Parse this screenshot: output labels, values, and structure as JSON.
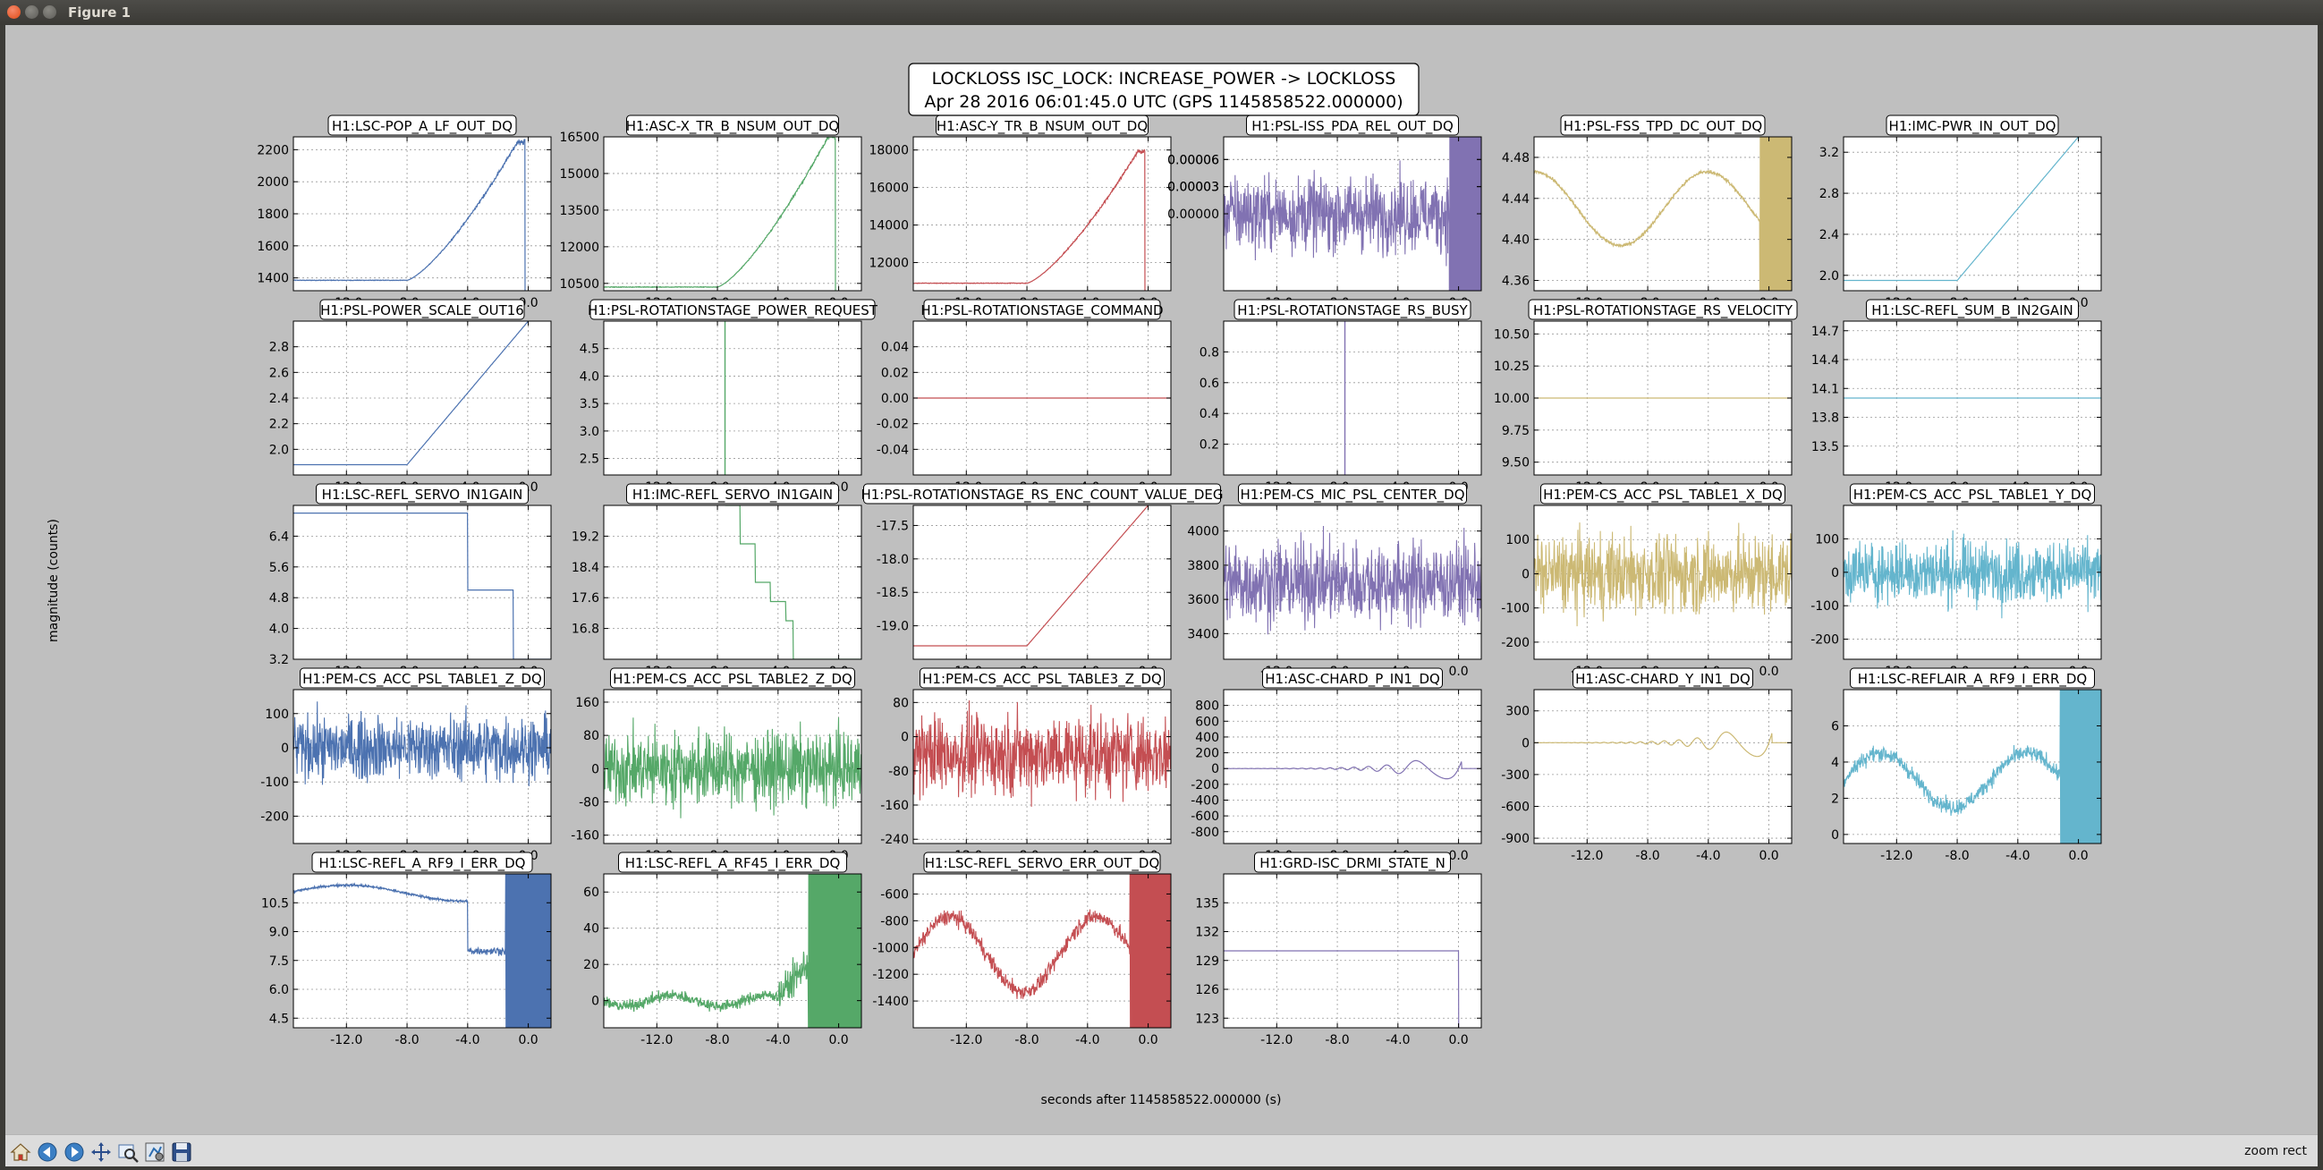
{
  "window": {
    "title": "Figure 1"
  },
  "figure": {
    "suptitle_line1": "LOCKLOSS ISC_LOCK: INCREASE_POWER -> LOCKLOSS",
    "suptitle_line2": "Apr 28 2016 06:01:45.0 UTC (GPS 1145858522.000000)",
    "ylabel": "magnitude (counts)",
    "xlabel": "seconds after 1145858522.000000 (s)"
  },
  "toolbar": {
    "icons": [
      "home-icon",
      "back-icon",
      "forward-icon",
      "pan-icon",
      "zoom-icon",
      "configure-icon",
      "save-icon"
    ],
    "status": "zoom rect"
  },
  "colors": {
    "blue": "#4c72b0",
    "green": "#55a868",
    "red": "#c44e52",
    "purple": "#8172b2",
    "gold": "#ccb974",
    "cyan": "#64b5cd"
  },
  "chart_data": [
    {
      "type": "line",
      "title": "H1:LSC-POP_A_LF_OUT_DQ",
      "color": "blue",
      "ylim": [
        1320,
        2280
      ],
      "yticks": [
        1400,
        1600,
        1800,
        2000,
        2200
      ],
      "xticks": [
        "-12.0",
        "-8.0",
        "-4.0",
        "0.0"
      ],
      "kind": "ramp",
      "base": 1385,
      "peak": 2250
    },
    {
      "type": "line",
      "title": "H1:ASC-X_TR_B_NSUM_OUT_DQ",
      "color": "green",
      "ylim": [
        10200,
        16500
      ],
      "yticks": [
        10500,
        12000,
        13500,
        15000,
        16500
      ],
      "xticks": [
        "-12.0",
        "-8.0",
        "-4.0",
        "0.0"
      ],
      "kind": "ramp",
      "base": 10350,
      "peak": 16500
    },
    {
      "type": "line",
      "title": "H1:ASC-Y_TR_B_NSUM_OUT_DQ",
      "color": "red",
      "ylim": [
        10500,
        18700
      ],
      "yticks": [
        12000,
        14000,
        16000,
        18000
      ],
      "xticks": [
        "-12.0",
        "-8.0",
        "-4.0",
        "0.0"
      ],
      "kind": "ramp",
      "base": 10900,
      "peak": 17900
    },
    {
      "type": "line",
      "title": "H1:PSL-ISS_PDA_REL_OUT_DQ",
      "color": "purple",
      "ylim": [
        -8.5e-05,
        8.5e-05
      ],
      "yticks": [
        "0.00006",
        "0.00003",
        "0.00000",
        "0.00003",
        "0.00006"
      ],
      "xticks": [
        "-12.0",
        "-8.0",
        "-4.0",
        "0.0"
      ],
      "kind": "noisewall",
      "amp": 5e-05
    },
    {
      "type": "line",
      "title": "H1:PSL-FSS_TPD_DC_OUT_DQ",
      "color": "gold",
      "ylim": [
        4.35,
        4.5
      ],
      "yticks": [
        "4.36",
        "4.40",
        "4.44",
        "4.48"
      ],
      "xticks": [
        "-12.0",
        "-8.0",
        "-4.0",
        "0.0"
      ],
      "kind": "wavefinal",
      "mid": 4.43,
      "amp": 0.04
    },
    {
      "type": "line",
      "title": "H1:IMC-PWR_IN_OUT_DQ",
      "color": "cyan",
      "ylim": [
        1.85,
        3.35
      ],
      "yticks": [
        "2.0",
        "2.4",
        "2.8",
        "3.2"
      ],
      "xticks": [
        "-12.0",
        "-8.0",
        "-4.0",
        "0.0"
      ],
      "kind": "linramp",
      "base": 1.95,
      "peak": 3.35
    },
    {
      "type": "line",
      "title": "H1:PSL-POWER_SCALE_OUT16",
      "color": "blue",
      "ylim": [
        1.8,
        3.0
      ],
      "yticks": [
        "2.0",
        "2.2",
        "2.4",
        "2.6",
        "2.8"
      ],
      "xticks": [
        "-12.0",
        "-8.0",
        "-4.0",
        "0.0"
      ],
      "kind": "linramp",
      "base": 1.88,
      "peak": 3.0
    },
    {
      "type": "line",
      "title": "H1:PSL-ROTATIONSTAGE_POWER_REQUEST",
      "color": "green",
      "ylim": [
        2.2,
        5.0
      ],
      "yticks": [
        "2.5",
        "3.0",
        "3.5",
        "4.0",
        "4.5"
      ],
      "xticks": [
        "-12.0",
        "-8.0",
        "-4.0",
        "0.0"
      ],
      "kind": "vline",
      "vx": -7.5
    },
    {
      "type": "line",
      "title": "H1:PSL-ROTATIONSTAGE_COMMAND",
      "color": "red",
      "ylim": [
        -0.06,
        0.06
      ],
      "yticks": [
        "0.04",
        "0.02",
        "0.00",
        "-0.02",
        "-0.04"
      ],
      "xticks": [
        "-12.0",
        "-8.0",
        "-4.0",
        "0.0"
      ],
      "kind": "flat",
      "level": 0
    },
    {
      "type": "line",
      "title": "H1:PSL-ROTATIONSTAGE_RS_BUSY",
      "color": "purple",
      "ylim": [
        0,
        1.0
      ],
      "yticks": [
        "0.2",
        "0.4",
        "0.6",
        "0.8"
      ],
      "xticks": [
        "-12.0",
        "-8.0",
        "-4.0",
        "0.0"
      ],
      "kind": "vline",
      "vx": -7.5
    },
    {
      "type": "line",
      "title": "H1:PSL-ROTATIONSTAGE_RS_VELOCITY",
      "color": "gold",
      "ylim": [
        9.4,
        10.6
      ],
      "yticks": [
        "9.50",
        "9.75",
        "10.00",
        "10.25",
        "10.50"
      ],
      "xticks": [
        "-12.0",
        "-8.0",
        "-4.0",
        "0.0"
      ],
      "kind": "flat",
      "level": 10.0
    },
    {
      "type": "line",
      "title": "H1:LSC-REFL_SUM_B_IN2GAIN",
      "color": "cyan",
      "ylim": [
        13.2,
        14.8
      ],
      "yticks": [
        "13.5",
        "13.8",
        "14.1",
        "14.4",
        "14.7"
      ],
      "xticks": [
        "-12.0",
        "-8.0",
        "-4.0",
        "0.0"
      ],
      "kind": "flat",
      "level": 14.0
    },
    {
      "type": "line",
      "title": "H1:LSC-REFL_SERVO_IN1GAIN",
      "color": "blue",
      "ylim": [
        3.2,
        7.2
      ],
      "yticks": [
        "3.2",
        "4.0",
        "4.8",
        "5.6",
        "6.4"
      ],
      "xticks": [
        "-12.0",
        "-8.0",
        "-4.0",
        "0.0"
      ],
      "kind": "steps",
      "steps": [
        [
          -15.5,
          7.0
        ],
        [
          -4.0,
          5.0
        ],
        [
          -1.0,
          3.2
        ]
      ]
    },
    {
      "type": "line",
      "title": "H1:IMC-REFL_SERVO_IN1GAIN",
      "color": "green",
      "ylim": [
        16.0,
        20.0
      ],
      "yticks": [
        "16.8",
        "17.6",
        "18.4",
        "19.2"
      ],
      "xticks": [
        "-12.0",
        "-8.0",
        "-4.0",
        "0.0"
      ],
      "kind": "steps",
      "steps": [
        [
          -7.5,
          20.0
        ],
        [
          -6.5,
          19.0
        ],
        [
          -5.5,
          18.0
        ],
        [
          -4.5,
          17.5
        ],
        [
          -3.5,
          17.0
        ],
        [
          -3.0,
          16.0
        ]
      ]
    },
    {
      "type": "line",
      "title": "H1:PSL-ROTATIONSTAGE_RS_ENC_COUNT_VALUE_DEG",
      "color": "red",
      "ylim": [
        -19.5,
        -17.2
      ],
      "yticks": [
        "-19.0",
        "-18.5",
        "-18.0",
        "-17.5"
      ],
      "xticks": [
        "-12.0",
        "-8.0",
        "-4.0",
        "0.0"
      ],
      "kind": "linramp",
      "base": -19.3,
      "peak": -17.2
    },
    {
      "type": "line",
      "title": "H1:PEM-CS_MIC_PSL_CENTER_DQ",
      "color": "purple",
      "ylim": [
        3250,
        4150
      ],
      "yticks": [
        3400,
        3600,
        3800,
        4000
      ],
      "xticks": [
        "-12.0",
        "-8.0",
        "-4.0",
        "0.0"
      ],
      "kind": "noise",
      "mid": 3700,
      "amp": 230
    },
    {
      "type": "line",
      "title": "H1:PEM-CS_ACC_PSL_TABLE1_X_DQ",
      "color": "gold",
      "ylim": [
        -250,
        200
      ],
      "yticks": [
        -200,
        -100,
        0,
        100
      ],
      "xticks": [
        "-12.0",
        "-8.0",
        "-4.0",
        "0.0"
      ],
      "kind": "noise",
      "mid": 0,
      "amp": 110
    },
    {
      "type": "line",
      "title": "H1:PEM-CS_ACC_PSL_TABLE1_Y_DQ",
      "color": "cyan",
      "ylim": [
        -260,
        200
      ],
      "yticks": [
        -200,
        -100,
        0,
        100
      ],
      "xticks": [
        "-12.0",
        "-8.0",
        "-4.0",
        "0.0"
      ],
      "kind": "noise",
      "mid": 0,
      "amp": 90
    },
    {
      "type": "line",
      "title": "H1:PEM-CS_ACC_PSL_TABLE1_Z_DQ",
      "color": "blue",
      "ylim": [
        -280,
        170
      ],
      "yticks": [
        -200,
        -100,
        0,
        100
      ],
      "xticks": [
        "-12.0",
        "-8.0",
        "-4.0",
        "0.0"
      ],
      "kind": "noise",
      "mid": 0,
      "amp": 90
    },
    {
      "type": "line",
      "title": "H1:PEM-CS_ACC_PSL_TABLE2_Z_DQ",
      "color": "green",
      "ylim": [
        -180,
        190
      ],
      "yticks": [
        -160,
        -80,
        0,
        80,
        160
      ],
      "xticks": [
        "-12.0",
        "-8.0",
        "-4.0",
        "0.0"
      ],
      "kind": "noise",
      "mid": 0,
      "amp": 85
    },
    {
      "type": "line",
      "title": "H1:PEM-CS_ACC_PSL_TABLE3_Z_DQ",
      "color": "red",
      "ylim": [
        -250,
        110
      ],
      "yticks": [
        -240,
        -160,
        -80,
        0,
        80
      ],
      "xticks": [
        "-12.0",
        "-8.0",
        "-4.0",
        "0.0"
      ],
      "kind": "noise",
      "mid": -40,
      "amp": 90
    },
    {
      "type": "line",
      "title": "H1:ASC-CHARD_P_IN1_DQ",
      "color": "purple",
      "ylim": [
        -950,
        1000
      ],
      "yticks": [
        -800,
        -600,
        -400,
        -200,
        0,
        200,
        400,
        600,
        800
      ],
      "xticks": [
        "-12.0",
        "-8.0",
        "-4.0",
        "0.0"
      ],
      "kind": "chirp",
      "amp": 900
    },
    {
      "type": "line",
      "title": "H1:ASC-CHARD_Y_IN1_DQ",
      "color": "gold",
      "ylim": [
        -950,
        500
      ],
      "yticks": [
        -900,
        -600,
        -300,
        0,
        300
      ],
      "xticks": [
        "-12.0",
        "-8.0",
        "-4.0",
        "0.0"
      ],
      "kind": "chirp",
      "amp": 900
    },
    {
      "type": "line",
      "title": "H1:LSC-REFLAIR_A_RF9_I_ERR_DQ",
      "color": "cyan",
      "ylim": [
        -0.5,
        8.0
      ],
      "yticks": [
        0,
        2,
        4,
        6
      ],
      "xticks": [
        "-12.0",
        "-8.0",
        "-4.0",
        "0.0"
      ],
      "kind": "thickwave",
      "mid": 3.0,
      "amp": 1.5
    },
    {
      "type": "line",
      "title": "H1:LSC-REFL_A_RF9_I_ERR_DQ",
      "color": "blue",
      "ylim": [
        4.0,
        12.0
      ],
      "yticks": [
        "4.5",
        "6.0",
        "7.5",
        "9.0",
        "10.5"
      ],
      "xticks": [
        "-12.0",
        "-8.0",
        "-4.0",
        "0.0"
      ],
      "kind": "hump",
      "mid": 11.0,
      "amp": 0.7
    },
    {
      "type": "line",
      "title": "H1:LSC-REFL_A_RF45_I_ERR_DQ",
      "color": "green",
      "ylim": [
        -15,
        70
      ],
      "yticks": [
        0,
        20,
        40,
        60
      ],
      "xticks": [
        "-12.0",
        "-8.0",
        "-4.0",
        "0.0"
      ],
      "kind": "risenoise",
      "mid": 0,
      "amp": 10
    },
    {
      "type": "line",
      "title": "H1:LSC-REFL_SERVO_ERR_OUT_DQ",
      "color": "red",
      "ylim": [
        -1600,
        -450
      ],
      "yticks": [
        -1400,
        -1200,
        -1000,
        -800,
        -600
      ],
      "xticks": [
        "-12.0",
        "-8.0",
        "-4.0",
        "0.0"
      ],
      "kind": "thickwave",
      "mid": -1050,
      "amp": 280
    },
    {
      "type": "line",
      "title": "H1:GRD-ISC_DRMI_STATE_N",
      "color": "purple",
      "ylim": [
        122,
        138
      ],
      "yticks": [
        123,
        126,
        129,
        132,
        135
      ],
      "xticks": [
        "-12.0",
        "-8.0",
        "-4.0",
        "0.0"
      ],
      "kind": "flatdrop",
      "level": 130
    }
  ]
}
